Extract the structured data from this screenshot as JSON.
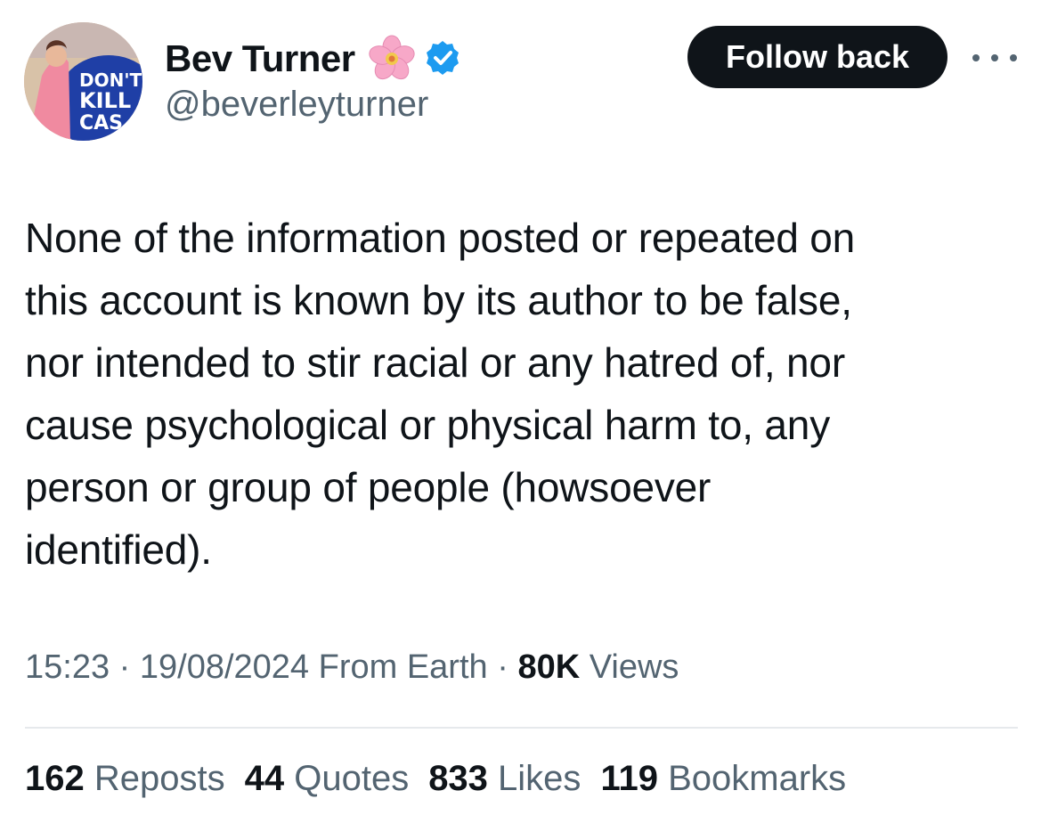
{
  "author": {
    "display_name": "Bev Turner",
    "handle": "@beverleyturner",
    "avatar_sign_text": [
      "DON'T",
      "KILL",
      "CAS"
    ],
    "name_emoji_icon": "cherry-blossom-icon",
    "verified_icon": "verified-badge-icon"
  },
  "header": {
    "follow_label": "Follow back",
    "more_icon": "more-options-icon"
  },
  "tweet": {
    "lines": [
      "None of the information posted or repeated on",
      "this account is known by its author to be false,",
      "nor intended to stir racial or any hatred of, nor",
      "cause psychological or physical harm to, any",
      "person or group of people (howsoever",
      "identified)."
    ]
  },
  "meta": {
    "time": "15:23",
    "sep1": " · ",
    "date": "19/08/2024",
    "source": " From Earth",
    "sep2": " · ",
    "views_count": "80K",
    "views_label": " Views"
  },
  "stats": [
    {
      "count": "162",
      "label": " Reposts"
    },
    {
      "count": "44",
      "label": " Quotes"
    },
    {
      "count": "833",
      "label": " Likes"
    },
    {
      "count": "119",
      "label": " Bookmarks"
    }
  ],
  "colors": {
    "text_primary": "#0f1419",
    "text_secondary": "#536471",
    "verified_blue": "#1d9bf0",
    "button_bg": "#0f1419"
  }
}
